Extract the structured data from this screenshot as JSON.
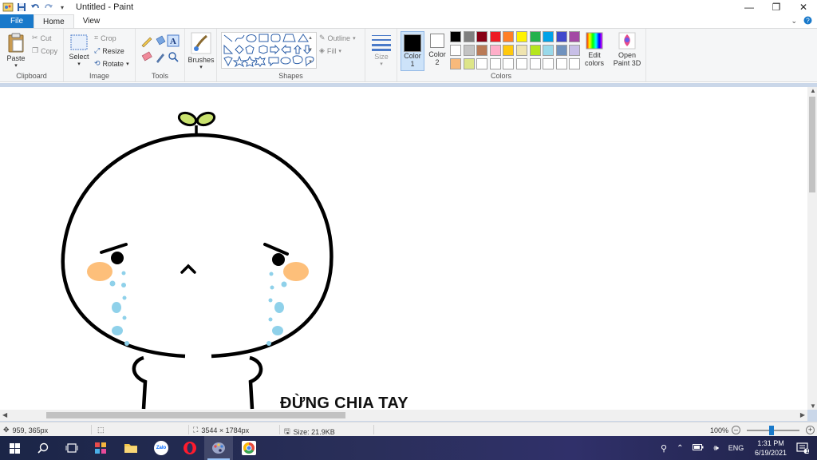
{
  "window": {
    "title": "Untitled - Paint",
    "minimize": "—",
    "maximize": "❐",
    "close": "✕"
  },
  "tabs": {
    "file": "File",
    "home": "Home",
    "view": "View"
  },
  "ribbon": {
    "clipboard": {
      "label": "Clipboard",
      "paste": "Paste",
      "cut": "Cut",
      "copy": "Copy"
    },
    "image": {
      "label": "Image",
      "select": "Select",
      "crop": "Crop",
      "resize": "Resize",
      "rotate": "Rotate"
    },
    "tools": {
      "label": "Tools"
    },
    "brushes": {
      "label": "Brushes"
    },
    "shapes": {
      "label": "Shapes",
      "outline": "Outline",
      "fill": "Fill"
    },
    "size": {
      "label": "Size"
    },
    "colors": {
      "label": "Colors",
      "color1": "Color",
      "color1_num": "1",
      "color2": "Color",
      "color2_num": "2",
      "edit_colors_line1": "Edit",
      "edit_colors_line2": "colors",
      "paint3d_line1": "Open",
      "paint3d_line2": "Paint 3D",
      "color1_value": "#000000",
      "color2_value": "#ffffff",
      "palette_row1": [
        "#000000",
        "#7f7f7f",
        "#880015",
        "#ed1c24",
        "#ff7f27",
        "#fff200",
        "#22b14c",
        "#00a2e8",
        "#3f48cc",
        "#a349a4"
      ],
      "palette_row2": [
        "#ffffff",
        "#c3c3c3",
        "#b97a57",
        "#ffaec9",
        "#ffc90e",
        "#efe4b0",
        "#b5e61d",
        "#99d9ea",
        "#7092be",
        "#c8bfe7"
      ],
      "palette_row3": [
        "#f7b97b",
        "#dde588",
        "#ffffff",
        "#ffffff",
        "#ffffff",
        "#ffffff",
        "#ffffff",
        "#ffffff",
        "#ffffff",
        "#ffffff"
      ]
    }
  },
  "canvas": {
    "caption": "ĐỪNG CHIA TAY"
  },
  "status": {
    "cursor": "959, 365px",
    "dimensions": "3544 × 1784px",
    "size": "Size: 21.9KB",
    "zoom": "100%"
  },
  "taskbar": {
    "apps": [
      "windows-start",
      "search",
      "task-view",
      "app-grid",
      "file-explorer",
      "zalo",
      "opera",
      "paint",
      "chrome"
    ],
    "zalo_label": "Zalo",
    "lang": "ENG",
    "time": "1:31 PM",
    "date": "6/19/2021",
    "notification_count": "1"
  }
}
